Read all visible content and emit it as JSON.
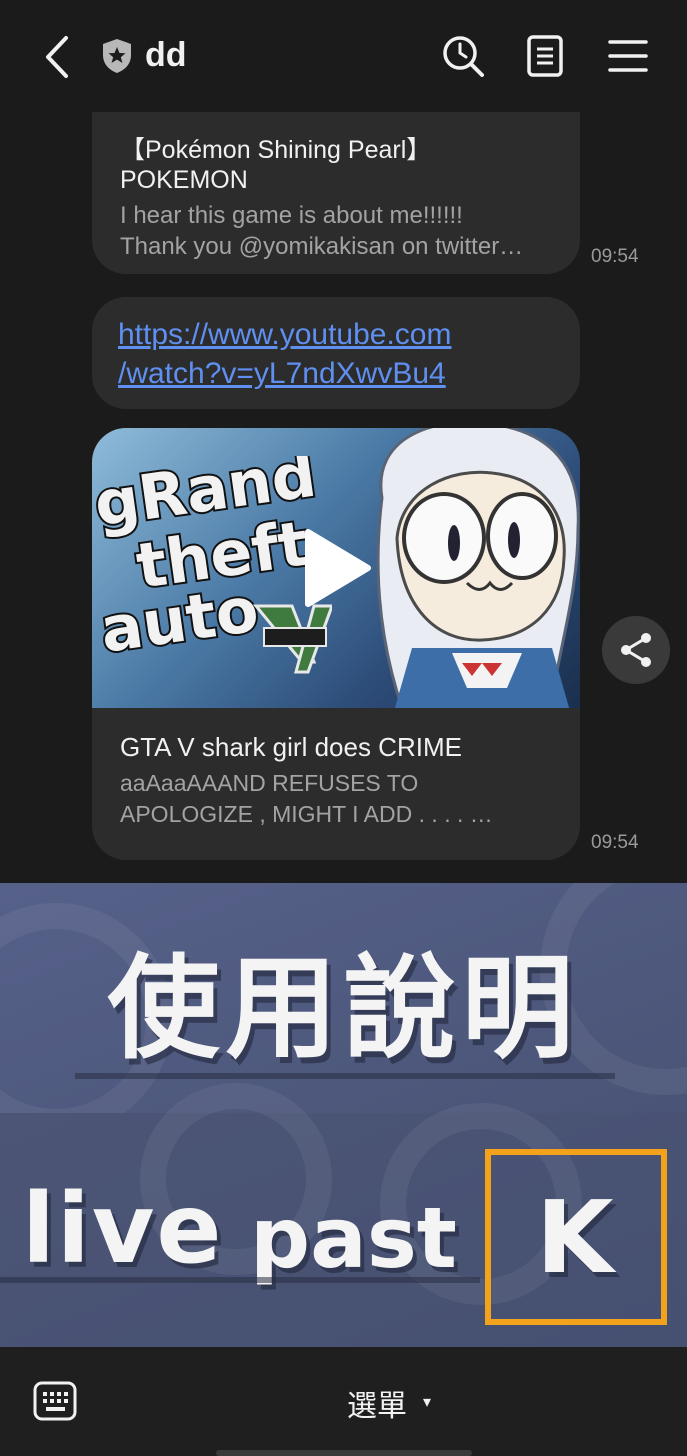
{
  "header": {
    "title": "dd",
    "icons": [
      "back-arrow-icon",
      "shield-star-icon",
      "search-clock-icon",
      "notes-icon",
      "menu-icon"
    ]
  },
  "messages": {
    "preview1": {
      "title_line1": "【Pokémon Shining Pearl】",
      "title_line2": "POKEMON",
      "desc_line1": "I hear this game is about me!!!!!!",
      "desc_line2": "Thank you @yomikakisan on twitter…",
      "time": "09:54"
    },
    "link_message": {
      "url_line1": "https://www.youtube.com",
      "url_line2": "/watch?v=yL7ndXwvBu4"
    },
    "video_card": {
      "title": "GTA V  shark girl does CRIME",
      "desc_line1": "aaAaaAAAND REFUSES TO",
      "desc_line2": "APOLOGIZE , MIGHT I ADD . . . . …",
      "time": "09:54"
    }
  },
  "rich_menu": {
    "heading": "使用說明",
    "live_label": "live",
    "past_label": "past",
    "k_label": "K",
    "accent_color": "#f3a21b"
  },
  "bottom_bar": {
    "menu_label": "選單",
    "caret": "▾"
  }
}
